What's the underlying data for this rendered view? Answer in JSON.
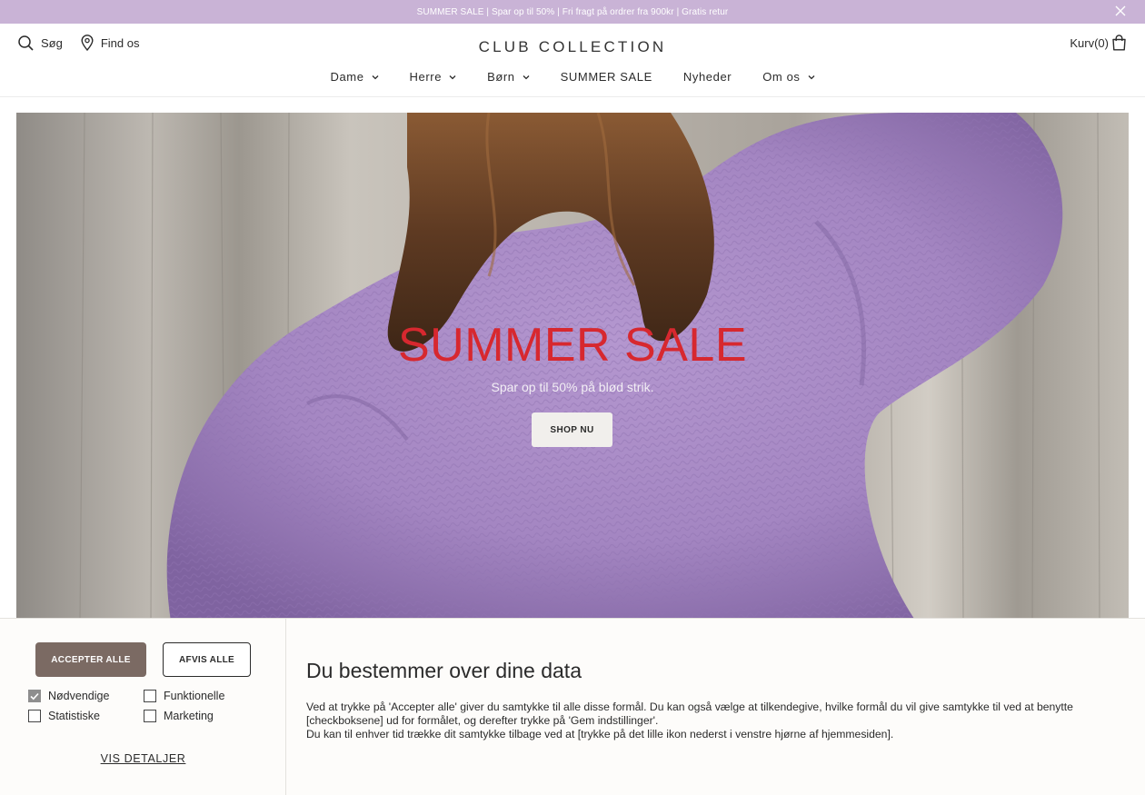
{
  "announcement": {
    "text": "SUMMER SALE | Spar op til 50% | Fri fragt på ordrer fra 900kr | Gratis retur",
    "close_icon": "close-icon"
  },
  "header": {
    "search_label": "Søg",
    "find_label": "Find os",
    "logo": "CLUB COLLECTION",
    "cart_label": "Kurv(0)",
    "icons": [
      "search-icon",
      "location-pin-icon",
      "shopping-bag-icon"
    ]
  },
  "nav": {
    "items": [
      {
        "label": "Dame",
        "has_dropdown": true
      },
      {
        "label": "Herre",
        "has_dropdown": true
      },
      {
        "label": "Børn",
        "has_dropdown": true
      },
      {
        "label": "SUMMER SALE",
        "has_dropdown": false
      },
      {
        "label": "Nyheder",
        "has_dropdown": false
      },
      {
        "label": "Om os",
        "has_dropdown": true
      }
    ]
  },
  "hero": {
    "title": "SUMMER SALE",
    "subtitle": "Spar op til 50% på blød strik.",
    "button": "SHOP NU"
  },
  "consent": {
    "accept_label": "ACCEPTER ALLE",
    "reject_label": "AFVIS ALLE",
    "checkboxes": [
      {
        "label": "Nødvendige",
        "checked": true
      },
      {
        "label": "Funktionelle",
        "checked": false
      },
      {
        "label": "Statistiske",
        "checked": false
      },
      {
        "label": "Marketing",
        "checked": false
      }
    ],
    "details_label": "VIS DETALJER",
    "title": "Du bestemmer over dine data",
    "text_line1": "Ved at trykke på 'Accepter alle' giver du samtykke til alle disse formål. Du kan også vælge at tilkendegive, hvilke formål du vil give samtykke til ved at benytte [checkboksene] ud for formålet, og derefter trykke på 'Gem indstillinger'.",
    "text_line2": "Du kan til enhver tid trække dit samtykke tilbage ved at [trykke på det lille ikon nederst i venstre hjørne af hjemmesiden]."
  },
  "colors": {
    "announcement_bg": "#c9b3d6",
    "accent_red": "#d7282f",
    "accept_button": "#7b6a63",
    "sweater_lilac": "#a98bc6"
  }
}
